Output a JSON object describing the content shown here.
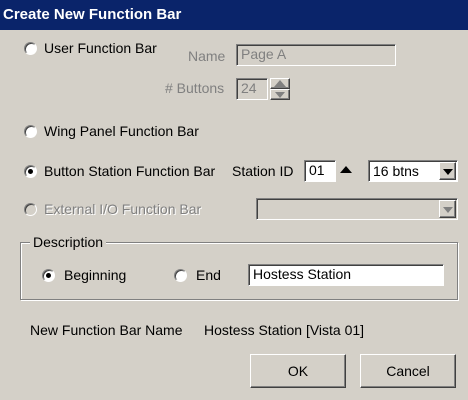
{
  "window": {
    "title": "Create New Function Bar"
  },
  "options": {
    "user_function_bar": {
      "label": "User Function Bar",
      "selected": false
    },
    "name_label": "Name",
    "name_value": "Page A",
    "buttons_label": "# Buttons",
    "buttons_value": "24",
    "wing_panel": {
      "label": "Wing Panel Function Bar",
      "selected": false
    },
    "button_station": {
      "label": "Button Station Function Bar",
      "selected": true
    },
    "station_id_label": "Station ID",
    "station_id_value": "01",
    "btns_select": "16 btns",
    "external_io": {
      "label": "External I/O Function Bar",
      "selected": false,
      "disabled": true
    },
    "external_io_select": ""
  },
  "description": {
    "legend": "Description",
    "beginning_label": "Beginning",
    "end_label": "End",
    "selected": "Beginning",
    "text_value": "Hostess Station"
  },
  "result": {
    "label": "New Function Bar Name",
    "value": "Hostess Station [Vista 01]"
  },
  "buttons": {
    "ok": "OK",
    "cancel": "Cancel"
  },
  "icons": [
    "radio-icon",
    "spin-up-icon",
    "spin-down-icon",
    "dropdown-arrow-icon"
  ]
}
